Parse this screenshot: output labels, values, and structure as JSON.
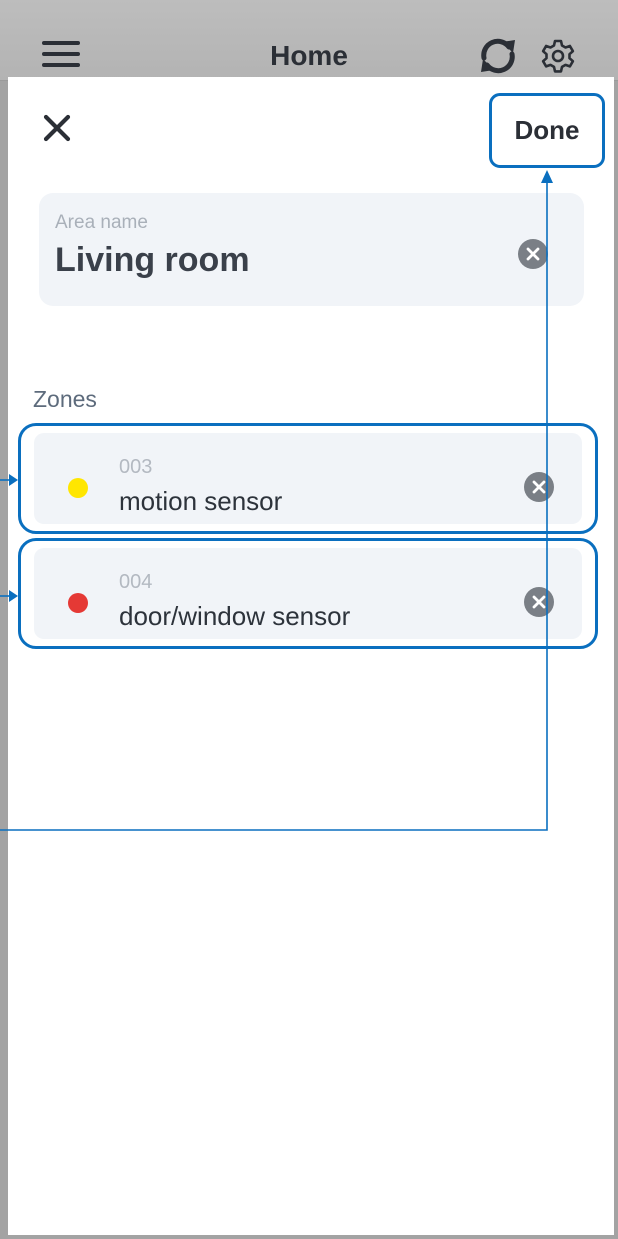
{
  "header": {
    "title": "Home",
    "icons": [
      "menu-icon",
      "refresh-icon",
      "gear-icon"
    ]
  },
  "sheet": {
    "close_icon": "close-icon",
    "done_label": "Done"
  },
  "area": {
    "label": "Area name",
    "value": "Living room",
    "clear_icon": "x-circle-icon"
  },
  "zones": {
    "label": "Zones",
    "items": [
      {
        "code": "003",
        "name": "motion sensor",
        "status_color": "#ffe600"
      },
      {
        "code": "004",
        "name": "door/window sensor",
        "status_color": "#e53935"
      }
    ]
  },
  "colors": {
    "accent": "#0a6fbf",
    "card_background": "#f1f4f8",
    "text_primary": "#2b2f36"
  }
}
